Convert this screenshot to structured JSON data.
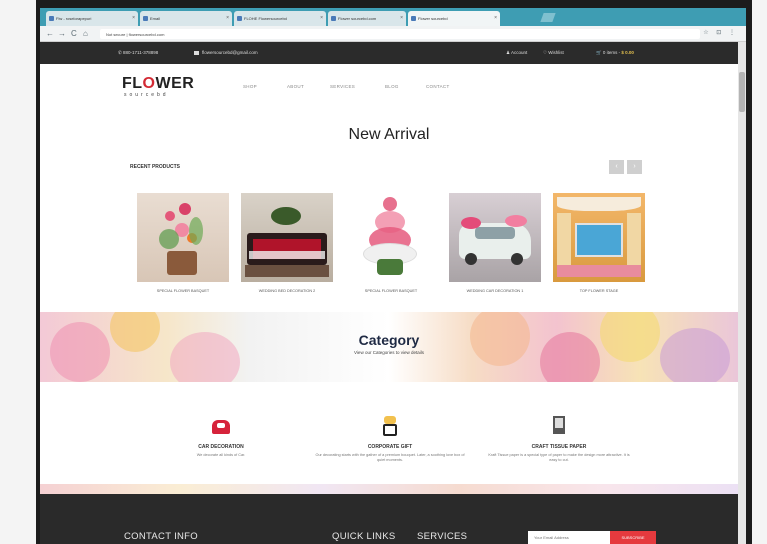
{
  "browser": {
    "tabs": [
      {
        "label": "Flw - roselorapepuri",
        "active": false
      },
      {
        "label": "Email",
        "active": false
      },
      {
        "label": "FLOHE Flowersourcebd",
        "active": false
      },
      {
        "label": "Flower sourcebd.com",
        "active": false
      },
      {
        "label": "Flower sourcebd",
        "active": true
      }
    ],
    "address": "Not secure | flowersourcebd.com",
    "back_icon": "←",
    "forward_icon": "→",
    "reload_icon": "C",
    "home_icon": "⌂",
    "right_icons": "☆ ⊡ ⋮"
  },
  "topbar": {
    "phone": "880-1711-378898",
    "email": "flowersourcebd@gmail.com",
    "account": "Account",
    "wishlist": "Wishlist",
    "cart_label": "0 items -",
    "cart_total": "$ 0.00"
  },
  "logo": {
    "part1": "FL",
    "o": "O",
    "part2": "WER",
    "sub": "sourcebd"
  },
  "nav": [
    "SHOP",
    "ABOUT",
    "SERVICES",
    "BLOG",
    "CONTACT"
  ],
  "page": {
    "title": "New Arrival",
    "recent_label": "RECENT PRODUCTS",
    "prev": "‹",
    "next": "›"
  },
  "products": [
    {
      "caption": "SPECIAL FLOWER BASQUET"
    },
    {
      "caption": "WEDDING BED DECORATION 2"
    },
    {
      "caption": "SPECIAL FLOWER BASQUET"
    },
    {
      "caption": "WEDDING CAR DECORATION 1"
    },
    {
      "caption": "TOP FLOWER STAGE"
    }
  ],
  "category": {
    "title": "Category",
    "subtitle": "View our Categories to view details"
  },
  "categories": [
    {
      "title": "CAR DECORATION",
      "desc": "We decorate all kinds of Car."
    },
    {
      "title": "CORPORATE GIFT",
      "desc": "Our decorating starts with the gather of a premium bouquet. Later, a soothing love box of quiet moments."
    },
    {
      "title": "CRAFT TISSUE PAPER",
      "desc": "Kraft Tissue paper is a special type of paper to make the design more attractive. It is easy to cut."
    }
  ],
  "footer": {
    "contact": "CONTACT INFO",
    "quick": "QUICK LINKS",
    "services": "SERVICES",
    "email_placeholder": "Your Email Address",
    "subscribe": "SUBSCRIBE"
  }
}
